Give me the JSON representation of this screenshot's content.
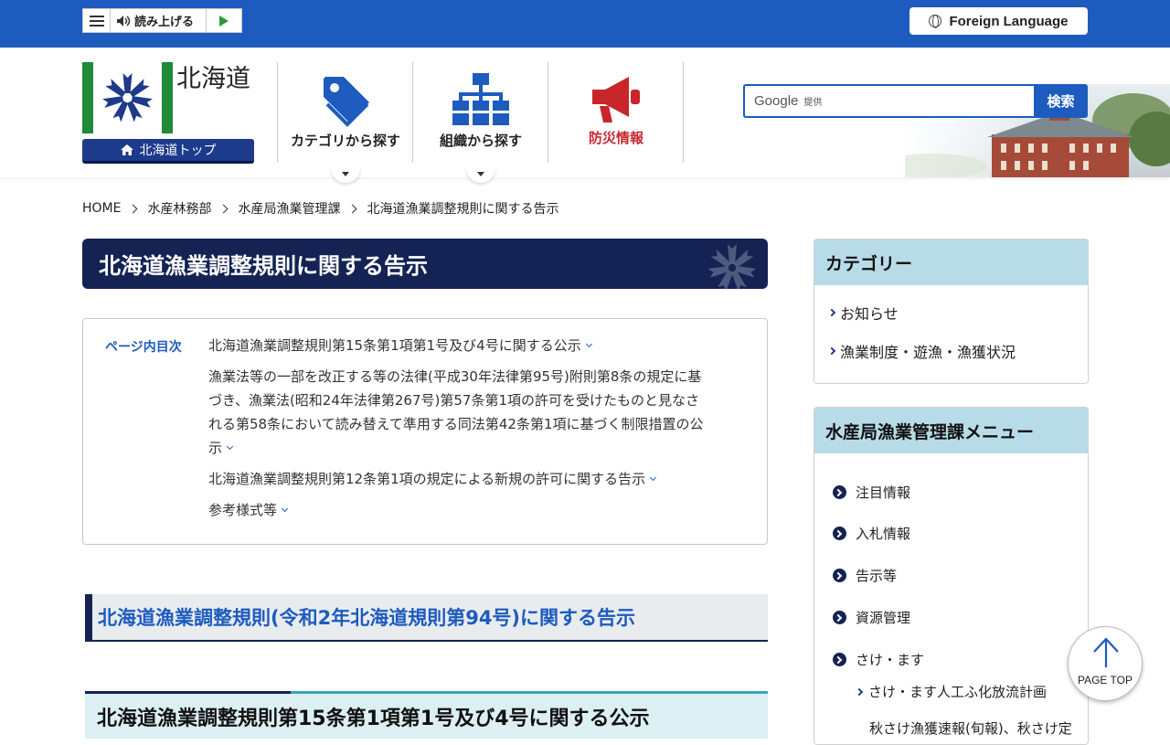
{
  "topbar": {
    "read_aloud_label": "読み上げる",
    "foreign_language_label": "Foreign Language"
  },
  "header": {
    "logo_text": "北海道",
    "top_button_label": "北海道トップ",
    "nav": [
      {
        "label": "カテゴリから探す",
        "icon": "tag-icon"
      },
      {
        "label": "組織から探す",
        "icon": "org-chart-icon"
      },
      {
        "label": "防災情報",
        "icon": "megaphone-icon"
      }
    ],
    "search": {
      "brand": "Google",
      "provided": "提供",
      "button_label": "検索"
    }
  },
  "breadcrumb": [
    "HOME",
    "水産林務部",
    "水産局漁業管理課",
    "北海道漁業調整規則に関する告示"
  ],
  "page_title": "北海道漁業調整規則に関する告示",
  "toc": {
    "label": "ページ内目次",
    "items": [
      "北海道漁業調整規則第15条第1項第1号及び4号に関する公示",
      "漁業法等の一部を改正する等の法律(平成30年法律第95号)附則第8条の規定に基づき、漁業法(昭和24年法律第267号)第57条第1項の許可を受けたものと見なされる第58条において読み替えて準用する同法第42条第1項に基づく制限措置の公示",
      "北海道漁業調整規則第12条第1項の規定による新規の許可に関する告示",
      "参考様式等"
    ]
  },
  "section_h2": "北海道漁業調整規則(令和2年北海道規則第94号)に関する告示",
  "section_h3": "北海道漁業調整規則第15条第1項第1号及び4号に関する公示",
  "sidebar": {
    "category": {
      "title": "カテゴリー",
      "links": [
        "お知らせ",
        "漁業制度・遊漁・漁獲状況"
      ]
    },
    "menu": {
      "title": "水産局漁業管理課メニュー",
      "links": [
        "注目情報",
        "入札情報",
        "告示等",
        "資源管理",
        "さけ・ます"
      ],
      "sub_links": [
        "さけ・ます人工ふ化放流計画",
        "秋さけ漁獲速報(旬報)、秋さけ定"
      ]
    }
  },
  "page_top_label": "PAGE TOP",
  "colors": {
    "brand_blue": "#1d5bbf",
    "navy": "#142354",
    "hokkaido_green": "#1e8a3a",
    "disaster_red": "#c8262b",
    "sidebar_head": "#b8dbe8"
  }
}
